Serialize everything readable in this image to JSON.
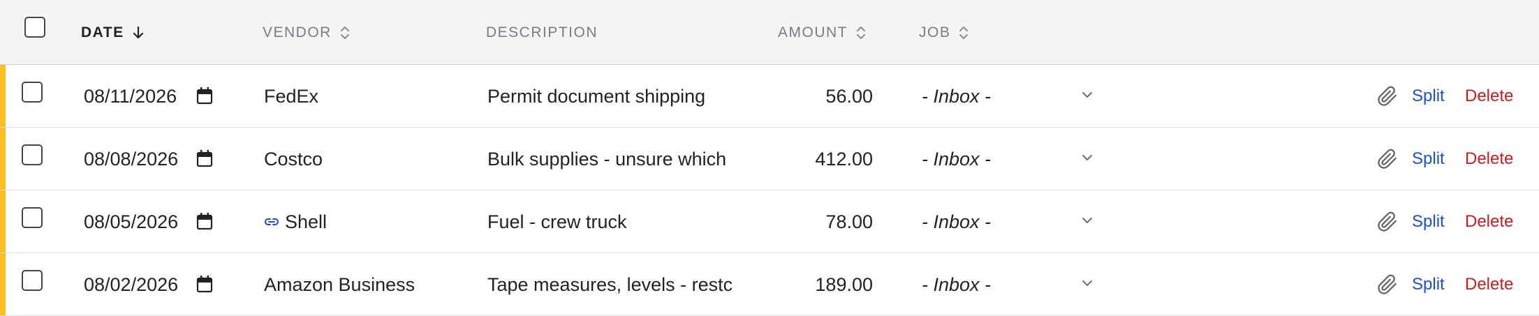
{
  "header": {
    "date": "DATE",
    "vendor": "VENDOR",
    "description": "DESCRIPTION",
    "amount": "AMOUNT",
    "job": "JOB"
  },
  "rows": [
    {
      "date": "08/11/2026",
      "vendor": "FedEx",
      "vendor_linked": false,
      "description": "Permit document shipping",
      "amount": "56.00",
      "job": "- Inbox -",
      "split": "Split",
      "delete": "Delete"
    },
    {
      "date": "08/08/2026",
      "vendor": "Costco",
      "vendor_linked": false,
      "description": "Bulk supplies - unsure which",
      "amount": "412.00",
      "job": "- Inbox -",
      "split": "Split",
      "delete": "Delete"
    },
    {
      "date": "08/05/2026",
      "vendor": "Shell",
      "vendor_linked": true,
      "description": "Fuel - crew truck",
      "amount": "78.00",
      "job": "- Inbox -",
      "split": "Split",
      "delete": "Delete"
    },
    {
      "date": "08/02/2026",
      "vendor": "Amazon Business",
      "vendor_linked": false,
      "description": "Tape measures, levels - restc",
      "amount": "189.00",
      "job": "- Inbox -",
      "split": "Split",
      "delete": "Delete"
    }
  ],
  "colors": {
    "accent": "#fbbf24",
    "link": "#1d4ed8",
    "danger": "#c81e1e"
  }
}
